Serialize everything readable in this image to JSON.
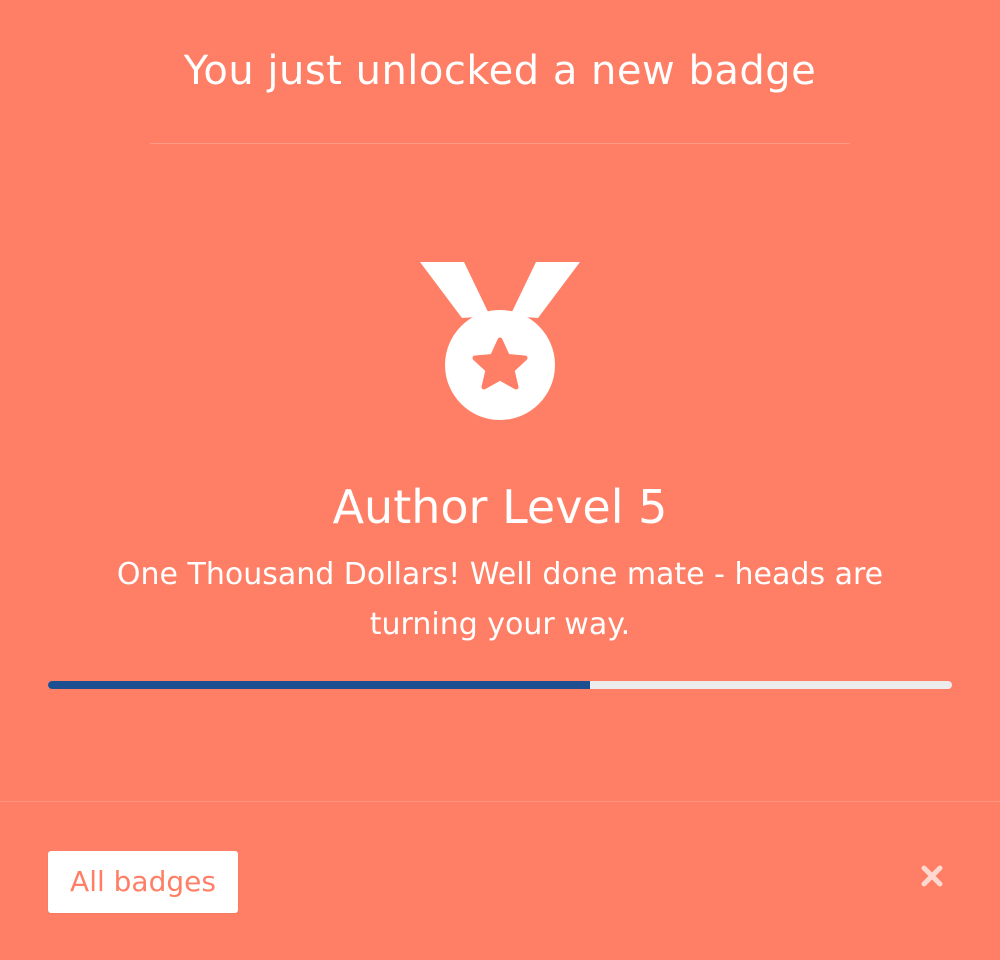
{
  "header": {
    "title": "You just unlocked a new badge"
  },
  "badge": {
    "icon": "medal-star-icon",
    "title": "Author Level 5",
    "description": "One Thousand Dollars! Well done mate - heads are turning your way.",
    "progress_percent": 60
  },
  "footer": {
    "all_badges_label": "All badges",
    "close_icon": "close-icon"
  },
  "colors": {
    "background": "#ff7f66",
    "progress_fill": "#1d4f91",
    "progress_track": "#ececec",
    "button_text": "#ff7f66"
  }
}
